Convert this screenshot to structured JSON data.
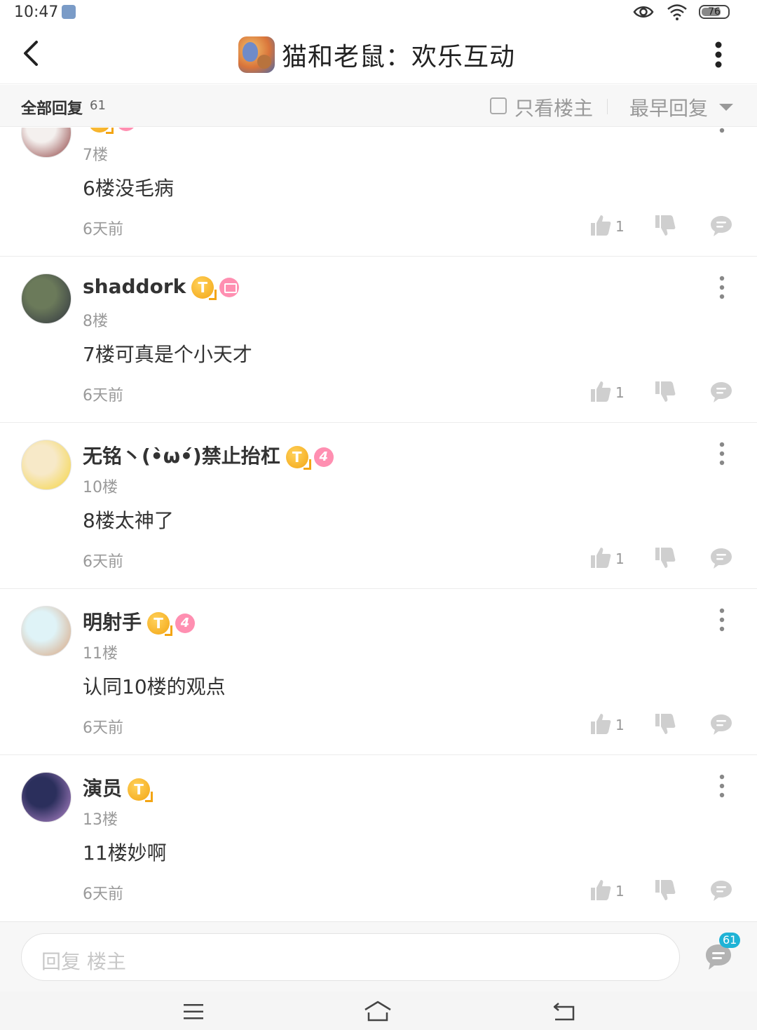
{
  "status_bar": {
    "time": "10:47",
    "battery": "76",
    "battery_level": 0.76,
    "icons": [
      "app-notification-icon",
      "eye-icon",
      "wifi-icon",
      "battery-icon"
    ]
  },
  "header": {
    "title": "猫和老鼠：欢乐互动",
    "icons": [
      "back-arrow-icon",
      "game-logo",
      "more-vertical-icon"
    ]
  },
  "filter": {
    "all_replies_label": "全部回复",
    "count": "61",
    "only_op_label": "只看楼主",
    "only_op_checked": false,
    "sort_label": "最早回复"
  },
  "replies": [
    {
      "username": "",
      "floor": "7楼",
      "content": "6楼没毛病",
      "time": "6天前",
      "likes": "1",
      "badges": [
        "title-badge",
        "level-badge"
      ],
      "avatar_colors": [
        "#f4f0ee",
        "#8b3a3a"
      ]
    },
    {
      "username": "shaddork",
      "floor": "8楼",
      "content": "7楼可真是个小天才",
      "time": "6天前",
      "likes": "1",
      "badge_t": "T",
      "badges": [
        "title-badge",
        "crown-badge"
      ],
      "avatar_colors": [
        "#6b7a5a",
        "#2f3340"
      ]
    },
    {
      "username": "无铭丶(•̀ω•́)禁止抬杠",
      "floor": "10楼",
      "content": "8楼太神了",
      "time": "6天前",
      "likes": "1",
      "badge_t": "T",
      "level": "4",
      "badges": [
        "title-badge",
        "level-badge"
      ],
      "avatar_colors": [
        "#f7e9c8",
        "#f5d33a"
      ]
    },
    {
      "username": "明射手",
      "floor": "11楼",
      "content": "认同10楼的观点",
      "time": "6天前",
      "likes": "1",
      "badge_t": "T",
      "level": "4",
      "badges": [
        "title-badge",
        "level-badge"
      ],
      "avatar_colors": [
        "#dff3f7",
        "#d9a27a"
      ]
    },
    {
      "username": "演员",
      "floor": "13楼",
      "content": "11楼妙啊",
      "time": "6天前",
      "likes": "1",
      "badge_t": "T",
      "badges": [
        "title-badge"
      ],
      "avatar_colors": [
        "#2b2f5c",
        "#b98ad0"
      ]
    }
  ],
  "input": {
    "placeholder": "回复  楼主",
    "comments_count": "61"
  },
  "nav": {
    "icons": [
      "menu-icon",
      "home-icon",
      "back-icon"
    ]
  },
  "colors": {
    "accent_badge_blue": "#1fb3d6",
    "badge_gold": "#f3a514",
    "badge_pink": "#ff8fb1",
    "muted_text": "#999999"
  }
}
